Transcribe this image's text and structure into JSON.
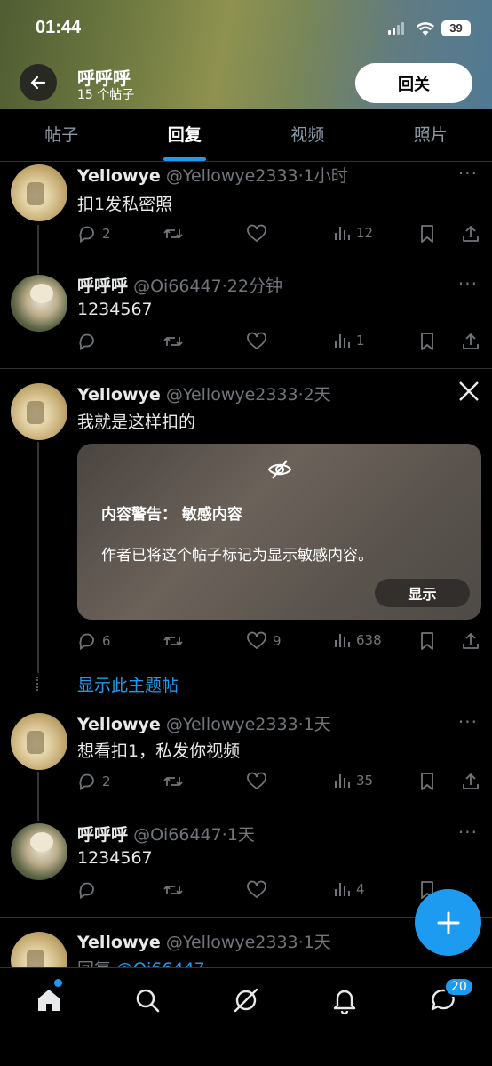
{
  "status_bar": {
    "time": "01:44",
    "battery": "39"
  },
  "header": {
    "title": "呼呼呼",
    "subtitle": "15 个帖子",
    "follow_label": "回关"
  },
  "tabs": [
    {
      "label": "帖子"
    },
    {
      "label": "回复",
      "active": true
    },
    {
      "label": "视频"
    },
    {
      "label": "照片"
    }
  ],
  "posts": [
    {
      "name": "Yellowye",
      "handle": "@Yellowye2333",
      "time": "·1小时",
      "text": "扣1发私密照",
      "replies": "2",
      "retweets": "",
      "likes": "",
      "views": "12"
    },
    {
      "name": "呼呼呼",
      "handle": "@Oi66447",
      "time": "·22分钟",
      "text": "1234567",
      "replies": "",
      "retweets": "",
      "likes": "",
      "views": "1"
    },
    {
      "name": "Yellowye",
      "handle": "@Yellowye2333",
      "time": "·2天",
      "text": "我就是这样扣的",
      "replies": "6",
      "retweets": "",
      "likes": "9",
      "views": "638",
      "warning": {
        "title": "内容警告：  敏感内容",
        "body": "作者已将这个帖子标记为显示敏感内容。",
        "show_label": "显示"
      }
    },
    {
      "name": "Yellowye",
      "handle": "@Yellowye2333",
      "time": "·1天",
      "text": "想看扣1，私发你视频",
      "replies": "2",
      "retweets": "",
      "likes": "",
      "views": "35"
    },
    {
      "name": "呼呼呼",
      "handle": "@Oi66447",
      "time": "·1天",
      "text": "1234567",
      "replies": "",
      "retweets": "",
      "likes": "",
      "views": "4"
    },
    {
      "name": "Yellowye",
      "handle": "@Yellowye2333",
      "time": "·1天",
      "text_prefix": "回复 ",
      "text_mention": "@Oi66447"
    }
  ],
  "show_thread_label": "显示此主题帖",
  "more_label": "···",
  "bottom_nav": {
    "messages_badge": "20"
  },
  "colors": {
    "accent": "#1d9bf0",
    "background": "#000000",
    "muted": "#71767b"
  }
}
